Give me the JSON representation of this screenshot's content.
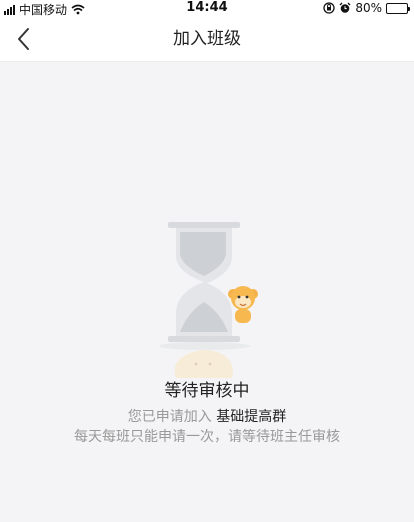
{
  "status_bar": {
    "carrier": "中国移动",
    "time": "14:44",
    "battery": "80%",
    "battery_level": 0.8,
    "icons": [
      "signal-icon",
      "wifi-icon",
      "orientation-lock-icon",
      "alarm-icon",
      "battery-icon"
    ]
  },
  "nav": {
    "title": "加入班级",
    "back_icon": "chevron-left-icon"
  },
  "illustration": {
    "icon": "hourglass-icon",
    "mascot": "monkey-mascot-icon"
  },
  "main": {
    "status_title": "等待审核中",
    "apply_prefix": "您已申请加入 ",
    "group_name": "基础提高群",
    "rule_text": "每天每班只能申请一次，请等待班主任审核"
  },
  "colors": {
    "background": "#f4f4f6",
    "text_primary": "#222222",
    "text_secondary": "#999999"
  }
}
